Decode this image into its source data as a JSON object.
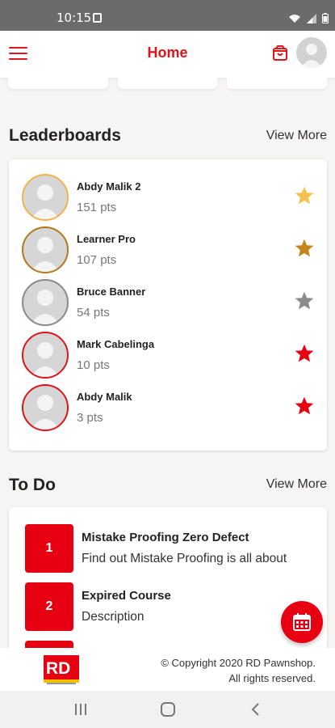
{
  "status": {
    "time": "10:15"
  },
  "header": {
    "title": "Home"
  },
  "leaderboards": {
    "title": "Leaderboards",
    "view_more": "View More",
    "entries": [
      {
        "name": "Abdy Malik 2",
        "points": "151 pts",
        "ring_color": "#f0b34a",
        "star_color": "#f6c04f"
      },
      {
        "name": "Learner Pro",
        "points": "107 pts",
        "ring_color": "#b37a1d",
        "star_color": "#c48518"
      },
      {
        "name": "Bruce Banner",
        "points": "54 pts",
        "ring_color": "#8a8a8a",
        "star_color": "#8c8c8c"
      },
      {
        "name": "Mark Cabelinga",
        "points": "10 pts",
        "ring_color": "#e0141b",
        "star_color": "#e60012"
      },
      {
        "name": "Abdy Malik",
        "points": "3 pts",
        "ring_color": "#e0141b",
        "star_color": "#e60012"
      }
    ]
  },
  "todo": {
    "title": "To Do",
    "view_more": "View More",
    "items": [
      {
        "number": "1",
        "title": "Mistake Proofing Zero Defect",
        "description": "Find out Mistake Proofing is all about"
      },
      {
        "number": "2",
        "title": "Expired Course",
        "description": "Description"
      }
    ]
  },
  "footer": {
    "logo_text": "RD",
    "copyright_line1": "© Copyright 2020 RD Pawnshop.",
    "copyright_line2": "All rights reserved."
  },
  "colors": {
    "accent": "#e0141b",
    "button_red": "#e60012"
  },
  "icons": {
    "menu": "hamburger-icon",
    "bag": "shopping-bag-icon",
    "fab": "calendar-icon"
  }
}
